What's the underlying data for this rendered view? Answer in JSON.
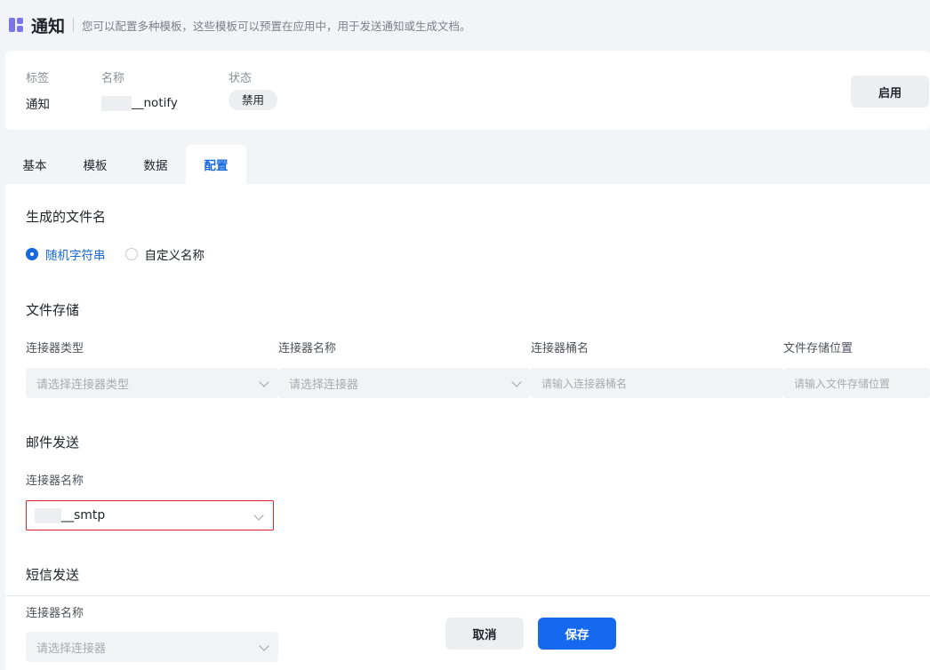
{
  "header": {
    "title": "通知",
    "description": "您可以配置多种模板，这些模板可以预置在应用中，用于发送通知或生成文档。"
  },
  "info": {
    "tag_label": "标签",
    "tag_value": "通知",
    "name_label": "名称",
    "name_suffix": "__notify",
    "status_label": "状态",
    "status_value": "禁用",
    "enable_button": "启用"
  },
  "tabs": [
    {
      "label": "基本",
      "active": false
    },
    {
      "label": "模板",
      "active": false
    },
    {
      "label": "数据",
      "active": false
    },
    {
      "label": "配置",
      "active": true
    }
  ],
  "filename": {
    "title": "生成的文件名",
    "options": [
      {
        "label": "随机字符串",
        "checked": true
      },
      {
        "label": "自定义名称",
        "checked": false
      }
    ]
  },
  "storage": {
    "title": "文件存储",
    "fields": [
      {
        "label": "连接器类型",
        "placeholder": "请选择连接器类型",
        "kind": "select"
      },
      {
        "label": "连接器名称",
        "placeholder": "请选择连接器",
        "kind": "select"
      },
      {
        "label": "连接器桶名",
        "placeholder": "请输入连接器桶名",
        "kind": "input"
      },
      {
        "label": "文件存储位置",
        "placeholder": "请输入文件存储位置",
        "kind": "input"
      }
    ]
  },
  "email": {
    "title": "邮件发送",
    "connector_label": "连接器名称",
    "connector_value_suffix": "__smtp"
  },
  "sms": {
    "title": "短信发送",
    "connector_label": "连接器名称",
    "connector_placeholder": "请选择连接器"
  },
  "footer": {
    "cancel": "取消",
    "save": "保存"
  },
  "colors": {
    "accent": "#1668dc",
    "primary_button": "#1668ef",
    "highlight_border": "#e0252b",
    "app_icon": "#7b76e8"
  }
}
